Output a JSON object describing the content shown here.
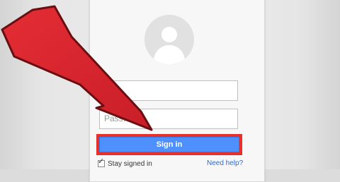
{
  "login": {
    "email_placeholder": "",
    "password_placeholder": "Password",
    "signin_label": "Sign in",
    "stay_signed_in_label": "Stay signed in",
    "stay_signed_in_checked": true,
    "need_help_label": "Need help?"
  },
  "colors": {
    "accent_blue": "#4d90fe",
    "highlight_red": "#e8302b",
    "link_blue": "#2a6ad9"
  },
  "icons": {
    "avatar": "person-silhouette-icon",
    "checkbox": "checkmark-icon",
    "overlay": "red-arrow-icon"
  }
}
